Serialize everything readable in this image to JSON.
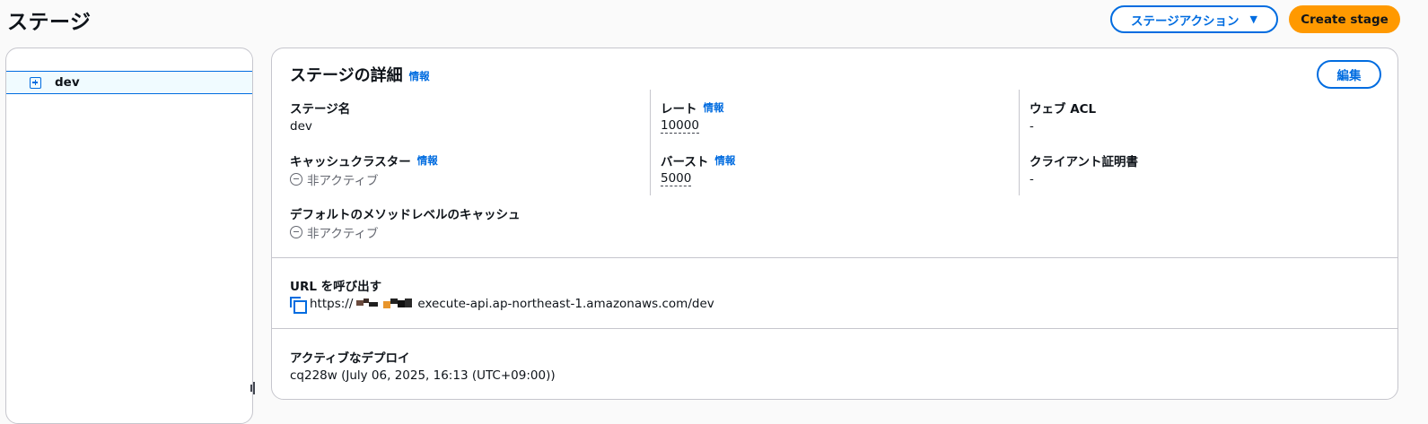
{
  "page": {
    "title": "ステージ",
    "stage_action_label": "ステージアクション",
    "create_stage_label": "Create stage"
  },
  "tree": {
    "items": [
      {
        "label": "dev"
      }
    ]
  },
  "details": {
    "title": "ステージの詳細",
    "info_label": "情報",
    "edit_label": "編集",
    "stage_name": {
      "label": "ステージ名",
      "value": "dev"
    },
    "cache_cluster": {
      "label": "キャッシュクラスター",
      "value": "非アクティブ"
    },
    "default_method_cache": {
      "label": "デフォルトのメソッドレベルのキャッシュ",
      "value": "非アクティブ"
    },
    "rate": {
      "label": "レート",
      "value": "10000"
    },
    "burst": {
      "label": "バースト",
      "value": "5000"
    },
    "web_acl": {
      "label": "ウェブ ACL",
      "value": "-"
    },
    "client_cert": {
      "label": "クライアント証明書",
      "value": "-"
    },
    "invoke_url": {
      "label": "URL を呼び出す",
      "prefix": "https://",
      "suffix": "execute-api.ap-northeast-1.amazonaws.com/dev"
    },
    "active_deployment": {
      "label": "アクティブなデプロイ",
      "value": "cq228w (July 06, 2025, 16:13 (UTC+09:00))"
    }
  },
  "colors": {
    "accent": "#006ce0",
    "primary_button": "#ff9900",
    "border": "#c6c6cd",
    "selected_row": "#f0fbff"
  }
}
